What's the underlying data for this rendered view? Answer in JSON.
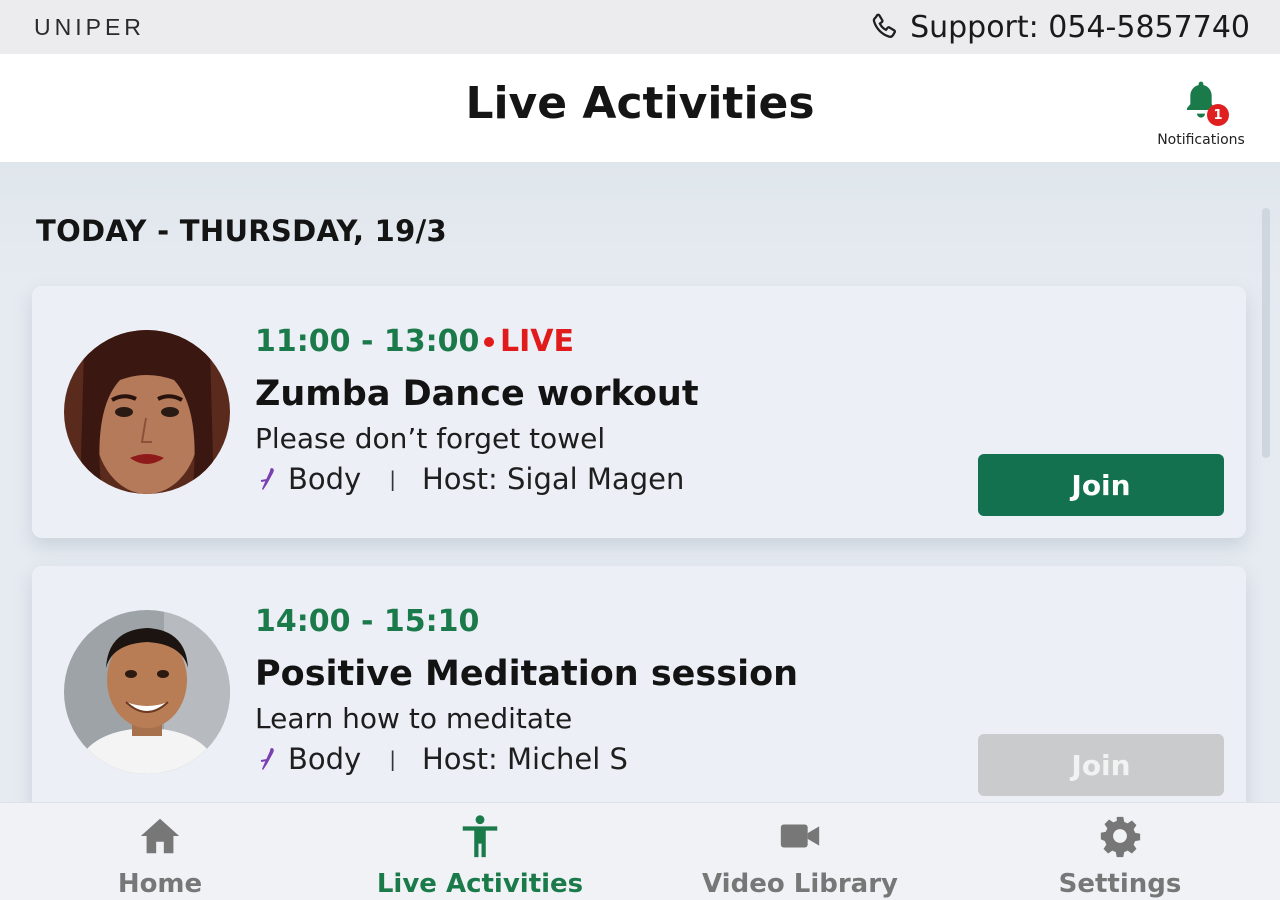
{
  "topbar": {
    "brand": "UNIPER",
    "support": "Support: 054-5857740"
  },
  "header": {
    "title": "Live Activities",
    "notifications_label": "Notifications",
    "notifications_count": "1"
  },
  "content": {
    "date_heading": "TODAY - THURSDAY, 19/3",
    "activities": [
      {
        "time": "11:00 - 13:00",
        "live_label": "LIVE",
        "title": "Zumba Dance workout",
        "description": "Please don’t forget towel",
        "category": "Body",
        "host": "Host: Sigal Magen",
        "join_label": "Join",
        "join_enabled": true
      },
      {
        "time": "14:00 - 15:10",
        "title": "Positive Meditation session",
        "description": "Learn how to meditate",
        "category": "Body",
        "host": "Host: Michel S",
        "join_label": "Join",
        "join_enabled": false
      }
    ]
  },
  "nav": {
    "items": [
      {
        "label": "Home",
        "icon": "home-icon",
        "active": false
      },
      {
        "label": "Live Activities",
        "icon": "person-activity-icon",
        "active": true
      },
      {
        "label": "Video Library",
        "icon": "video-camera-icon",
        "active": false
      },
      {
        "label": "Settings",
        "icon": "gear-icon",
        "active": false
      }
    ]
  },
  "colors": {
    "accent_green": "#137150",
    "time_green": "#1b7a4a",
    "live_red": "#e11b1b",
    "badge_red": "#e02020",
    "category_purple": "#7b3fb2"
  }
}
